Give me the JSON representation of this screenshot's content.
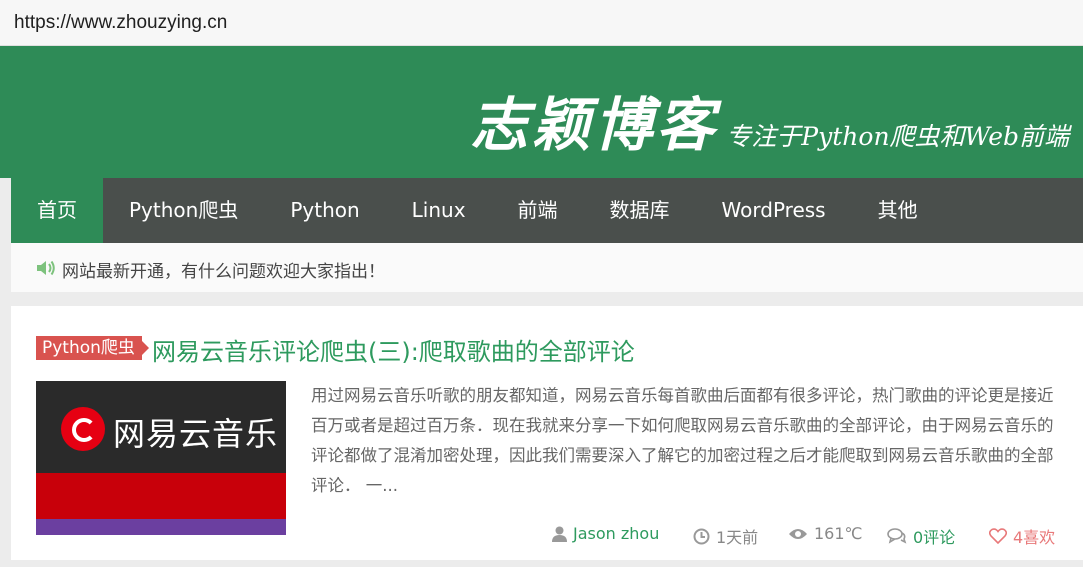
{
  "browser": {
    "url": "https://www.zhouzying.cn"
  },
  "site": {
    "name": "志颖博客",
    "slogan": "专注于Python爬虫和Web前端"
  },
  "nav": {
    "items": [
      {
        "label": "首页",
        "active": true
      },
      {
        "label": "Python爬虫",
        "active": false
      },
      {
        "label": "Python",
        "active": false
      },
      {
        "label": "Linux",
        "active": false
      },
      {
        "label": "前端",
        "active": false
      },
      {
        "label": "数据库",
        "active": false
      },
      {
        "label": "WordPress",
        "active": false
      },
      {
        "label": "其他",
        "active": false
      }
    ]
  },
  "notice": {
    "icon": "speaker-icon",
    "text": "网站最新开通，有什么问题欢迎大家指出！"
  },
  "post": {
    "category": "Python爬虫",
    "title": "网易云音乐评论爬虫(三):爬取歌曲的全部评论",
    "thumbnail_text": "网易云音乐",
    "excerpt": "用过网易云音乐听歌的朋友都知道，网易云音乐每首歌曲后面都有很多评论，热门歌曲的评论更是接近百万或者是超过百万条．现在我就来分享一下如何爬取网易云音乐歌曲的全部评论，由于网易云音乐的评论都做了混淆加密处理，因此我们需要深入了解它的加密过程之后才能爬取到网易云音乐歌曲的全部评论．  一...",
    "meta": {
      "author": "Jason zhou",
      "time": "1天前",
      "views": "161℃",
      "comments": "0评论",
      "likes": "4喜欢"
    }
  },
  "colors": {
    "brand_green": "#2e8b57",
    "nav_bg": "#4a4f4c",
    "category_red": "#d9534f",
    "link_green": "#2e9a5e",
    "like_pink": "#e8797a"
  }
}
